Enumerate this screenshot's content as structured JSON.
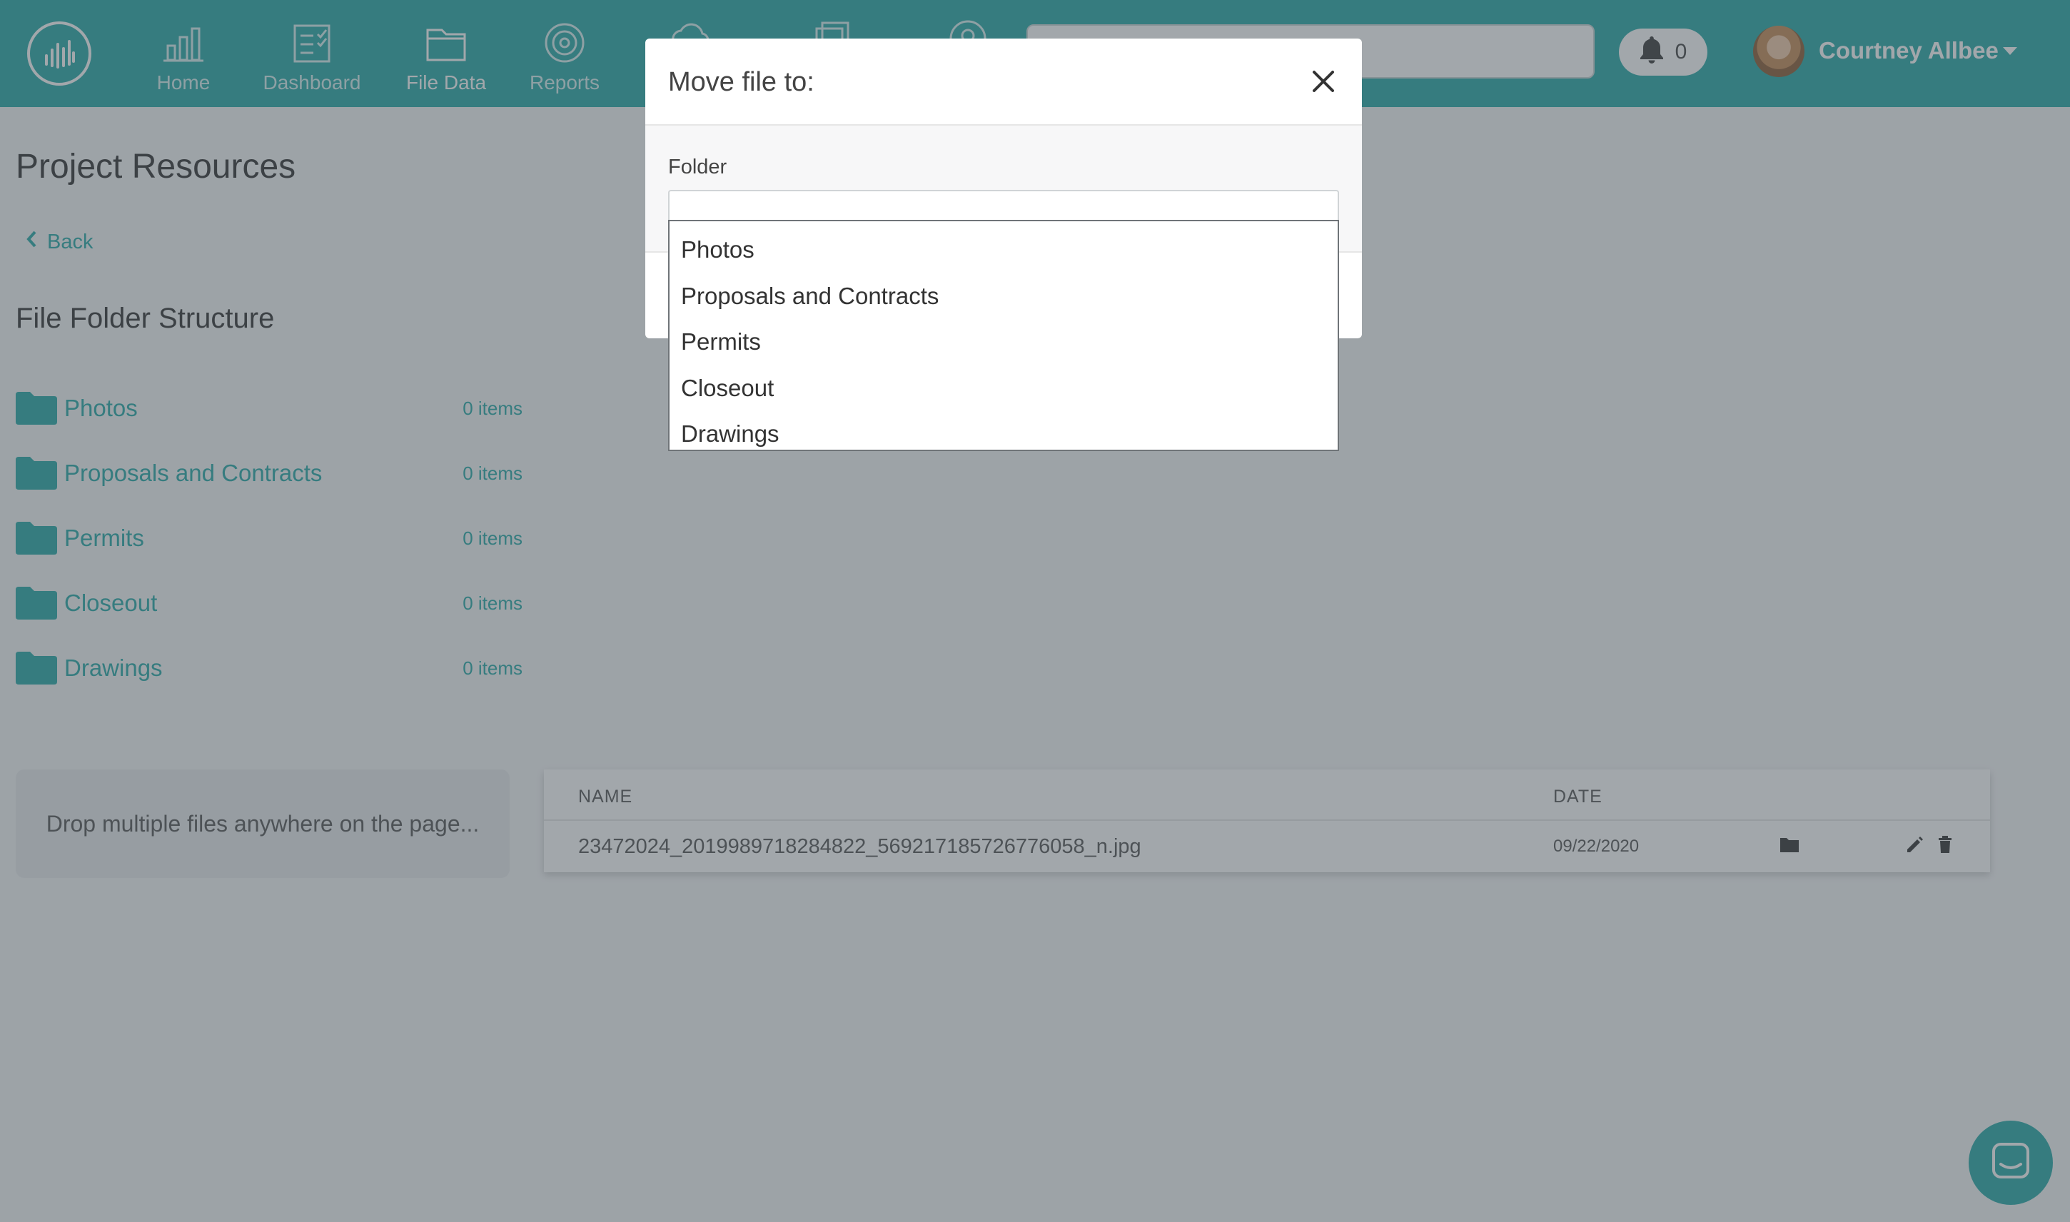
{
  "nav": {
    "items": [
      {
        "label": "Home",
        "icon": "bar-chart-icon"
      },
      {
        "label": "Dashboard",
        "icon": "checklist-icon"
      },
      {
        "label": "File Data",
        "icon": "folder-icon",
        "active": true
      },
      {
        "label": "Reports",
        "icon": "target-icon"
      }
    ],
    "notifications_count": "0",
    "user_name": "Courtney Allbee"
  },
  "page": {
    "title": "Project Resources",
    "back_label": "Back",
    "section_title": "File Folder Structure",
    "folders": [
      {
        "name": "Photos",
        "count": "0 items"
      },
      {
        "name": "Proposals and Contracts",
        "count": "0 items"
      },
      {
        "name": "Permits",
        "count": "0 items"
      },
      {
        "name": "Closeout",
        "count": "0 items"
      },
      {
        "name": "Drawings",
        "count": "0 items"
      }
    ],
    "dropzone_text": "Drop multiple files anywhere on the page...",
    "table": {
      "headers": {
        "name": "NAME",
        "date": "DATE"
      },
      "rows": [
        {
          "name": "23472024_2019989718284822_569217185726776058_n.jpg",
          "date": "09/22/2020"
        }
      ]
    }
  },
  "modal": {
    "title": "Move file to:",
    "field_label": "Folder",
    "folder_value": "",
    "options": [
      "Photos",
      "Proposals and Contracts",
      "Permits",
      "Closeout",
      "Drawings"
    ]
  },
  "colors": {
    "brand": "#26a9a6",
    "overlay": "rgba(70,80,88,0.5)"
  }
}
